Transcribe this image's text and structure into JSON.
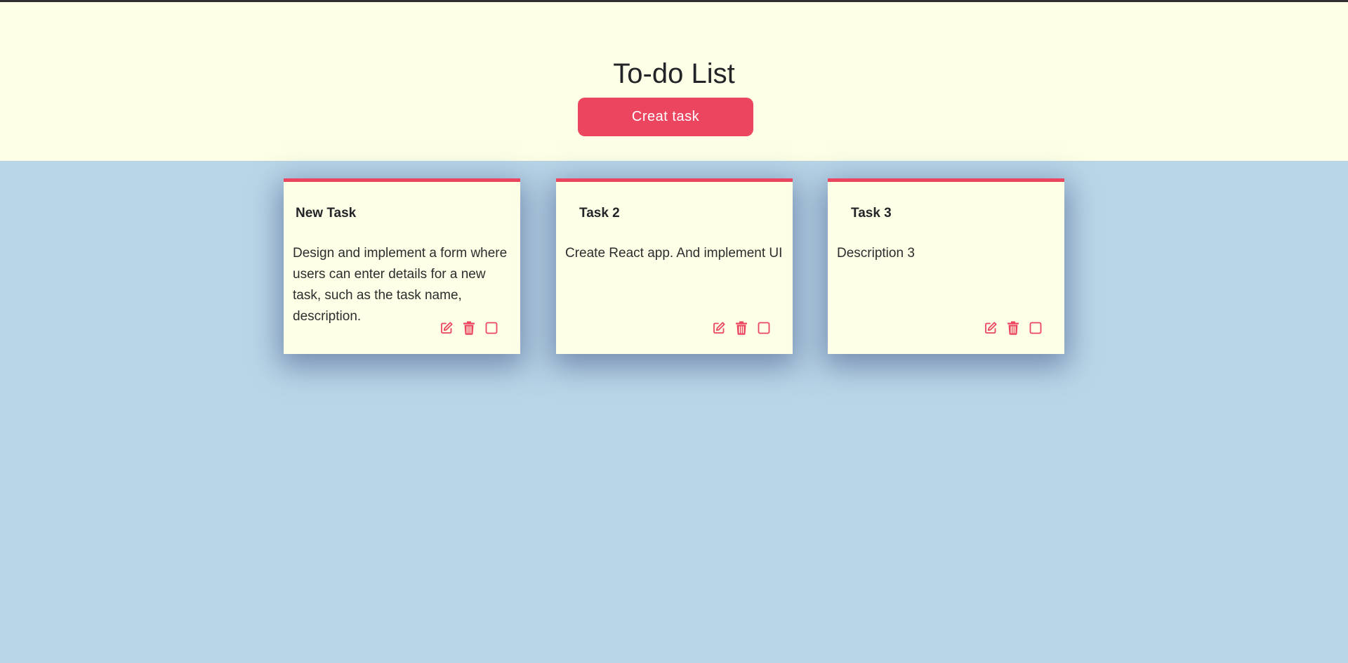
{
  "app": {
    "title": "To-do List",
    "create_button_label": "Creat task",
    "accent_color": "#eb4560",
    "header_bg": "#fdffe6",
    "page_bg": "#b9d6e8"
  },
  "tasks": [
    {
      "title": "New Task",
      "description": "Design and implement a form where users can enter details for a new task, such as the task name, description.",
      "actions": [
        "edit-icon",
        "trash-icon",
        "checkbox-icon"
      ]
    },
    {
      "title": "Task 2",
      "description": "Create React app. And implement UI",
      "actions": [
        "edit-icon",
        "trash-icon",
        "checkbox-icon"
      ]
    },
    {
      "title": "Task 3",
      "description": "Description 3",
      "actions": [
        "edit-icon",
        "trash-icon",
        "checkbox-icon"
      ]
    }
  ]
}
